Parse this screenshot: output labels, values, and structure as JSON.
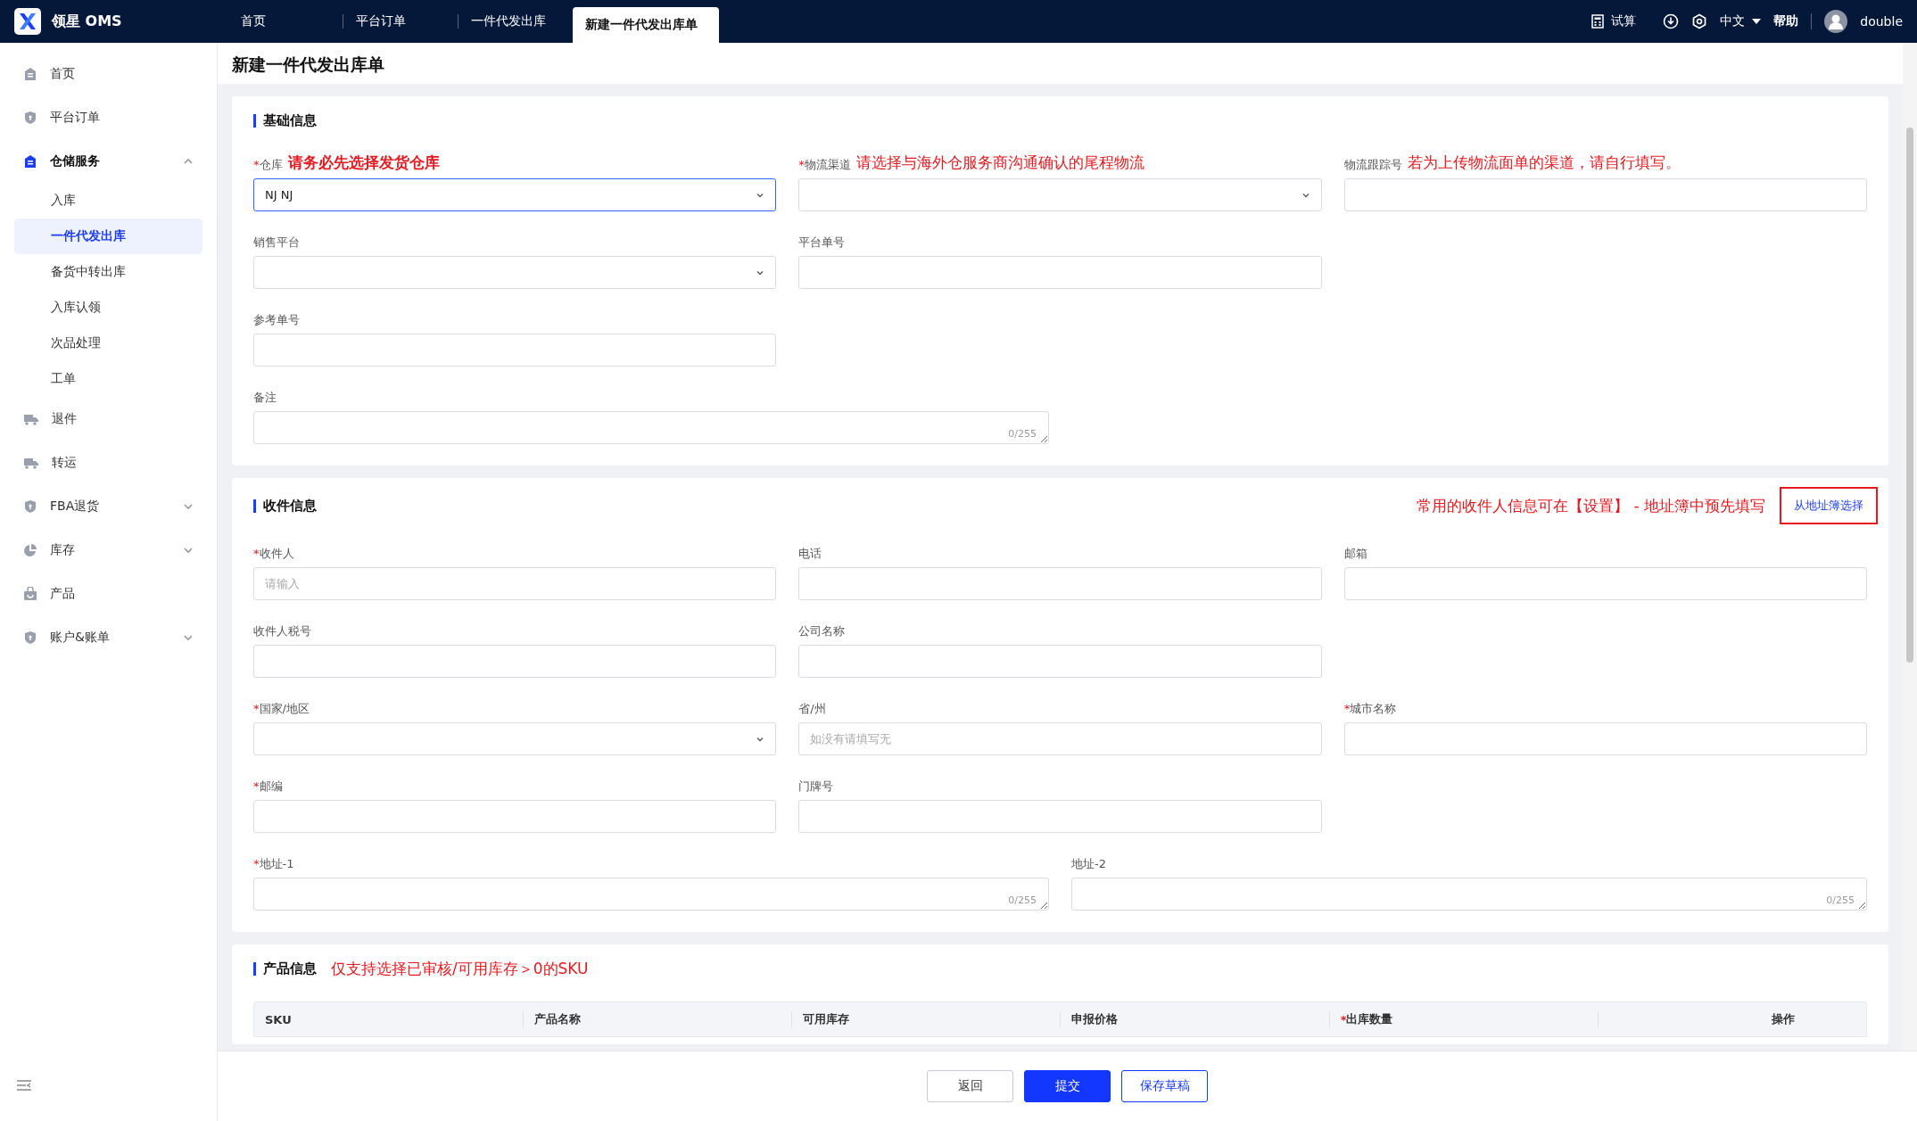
{
  "app": {
    "name": "领星 OMS"
  },
  "required_mark": "*",
  "top_tabs": [
    {
      "label": "首页",
      "selected": false
    },
    {
      "label": "平台订单",
      "selected": false
    },
    {
      "label": "一件代发出库",
      "selected": false
    },
    {
      "label": "新建一件代发出库单",
      "selected": true
    }
  ],
  "top_actions": {
    "calc": "试算",
    "language": "中文",
    "help": "帮助",
    "user": "double"
  },
  "sidebar": {
    "items": [
      {
        "label": "首页",
        "active": false
      },
      {
        "label": "平台订单",
        "active": false
      },
      {
        "label": "仓储服务",
        "active": true,
        "expanded": true,
        "children": [
          {
            "label": "入库",
            "selected": false
          },
          {
            "label": "一件代发出库",
            "selected": true
          },
          {
            "label": "备货中转出库",
            "selected": false
          },
          {
            "label": "入库认领",
            "selected": false
          },
          {
            "label": "次品处理",
            "selected": false
          },
          {
            "label": "工单",
            "selected": false
          }
        ]
      },
      {
        "label": "退件",
        "active": false
      },
      {
        "label": "转运",
        "active": false
      },
      {
        "label": "FBA退货",
        "active": false,
        "expanded": false
      },
      {
        "label": "库存",
        "active": false,
        "expanded": false
      },
      {
        "label": "产品",
        "active": false
      },
      {
        "label": "账户&账单",
        "active": false,
        "expanded": false
      }
    ]
  },
  "page_title": "新建一件代发出库单",
  "sections": [
    {
      "title": "基础信息",
      "rows": [
        [
          {
            "label": "仓库",
            "required": true,
            "kind": "select",
            "value": "NJ NJ",
            "focused": true,
            "hint": {
              "text": "请务必先选择发货仓库",
              "bold": true
            }
          },
          {
            "label": "物流渠道",
            "required": true,
            "kind": "select",
            "hint": {
              "text": "请选择与海外仓服务商沟通确认的尾程物流",
              "bold": false
            }
          },
          {
            "label": "物流跟踪号",
            "required": false,
            "kind": "input",
            "hint": {
              "text": "若为上传物流面单的渠道，请自行填写。",
              "bold": false
            }
          }
        ],
        [
          {
            "label": "销售平台",
            "required": false,
            "kind": "select"
          },
          {
            "label": "平台单号",
            "required": false,
            "kind": "input"
          }
        ],
        [
          {
            "label": "参考单号",
            "required": false,
            "kind": "input"
          }
        ]
      ],
      "wide_row": [
        {
          "label": "备注",
          "required": false,
          "kind": "textarea",
          "counter": "0/255"
        }
      ]
    },
    {
      "title": "收件信息",
      "note": "常用的收件人信息可在【设置】 - 地址簿中预先填写",
      "action": "从地址簿选择",
      "rows": [
        [
          {
            "label": "收件人",
            "required": true,
            "kind": "input",
            "placeholder": "请输入"
          },
          {
            "label": "电话",
            "required": false,
            "kind": "input"
          },
          {
            "label": "邮箱",
            "required": false,
            "kind": "input"
          }
        ],
        [
          {
            "label": "收件人税号",
            "required": false,
            "kind": "input"
          },
          {
            "label": "公司名称",
            "required": false,
            "kind": "input"
          }
        ],
        [
          {
            "label": "国家/地区",
            "required": true,
            "kind": "select"
          },
          {
            "label": "省/州",
            "required": false,
            "kind": "input",
            "placeholder": "如没有请填写无"
          },
          {
            "label": "城市名称",
            "required": true,
            "kind": "input"
          }
        ],
        [
          {
            "label": "邮编",
            "required": true,
            "kind": "input"
          },
          {
            "label": "门牌号",
            "required": false,
            "kind": "input"
          }
        ]
      ],
      "wide_row": [
        {
          "label": "地址-1",
          "required": true,
          "kind": "textarea",
          "counter": "0/255"
        },
        {
          "label": "地址-2",
          "required": false,
          "kind": "textarea",
          "counter": "0/255"
        }
      ]
    },
    {
      "title": "产品信息",
      "note_inline": "仅支持选择已审核/可用库存＞0的SKU",
      "table": {
        "columns": [
          {
            "label": "SKU",
            "required": false
          },
          {
            "label": "产品名称",
            "required": false
          },
          {
            "label": "可用库存",
            "required": false
          },
          {
            "label": "申报价格",
            "required": false
          },
          {
            "label": "出库数量",
            "required": true
          },
          {
            "label": "操作",
            "required": false
          }
        ]
      }
    }
  ],
  "footer_buttons": [
    {
      "label": "返回",
      "kind": "default"
    },
    {
      "label": "提交",
      "kind": "primary"
    },
    {
      "label": "保存草稿",
      "kind": "outline"
    }
  ]
}
